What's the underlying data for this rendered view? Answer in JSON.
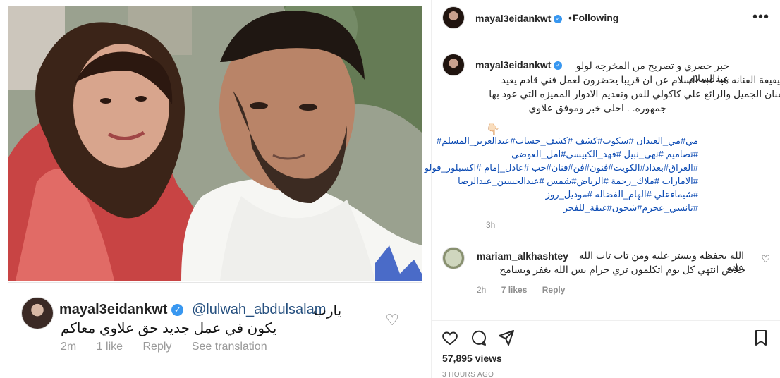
{
  "embedded_comment": {
    "username": "mayal3eidankwt",
    "mention": "@lulwah_abdulsalam",
    "text_line1": "يارب",
    "text_line2": "يكون في عمل جديد حق علاوي معاكم",
    "time": "2m",
    "likes": "1 like",
    "reply": "Reply",
    "translation": "See translation"
  },
  "header": {
    "username": "mayal3eidankwt",
    "following_label": "Following"
  },
  "caption": {
    "username": "mayal3eidankwt",
    "line1": "خبر حصري و تصريح من المخرجه لولو عبدالسلام",
    "line2": "شيقيقة الفنانه هيا عبد السلام عن ان قريبا يحضرون لعمل فني قادم يعيد",
    "line3": "الفنان الجميل والرائع علي كاكولي للفن وتقديم الادوار المميزه التي عود بها",
    "line4": "جمهوره. . احلى خبر وموفق علاوي",
    "emoji": "👇🏻",
    "hashtags": [
      "مي#مي_العيدان #سكوب#كشف #كشف_حساب#عبدالعزيز_المسلم#",
      "#تصاميم #نهى_نبيل #فهد_الكبيسي#امل_العوضي",
      "#العراق#بغداد#الكويت#فنون#فن#فنان#حب #عادل_إمام #اكسبلور_فولو",
      "#الامارات #ملاك_رحمة #الرياض#شمس #عبدالحسين_عبدالرضا",
      "#شيماءعلي #الهام_الفضاله #موديل_روز",
      "#نانسي_عجرم#شجون#غبقة_للفجر"
    ],
    "time": "3h"
  },
  "comment": {
    "username": "mariam_alkhashtey",
    "line1": "الله يحفظه ويستر عليه ومن تاب تاب الله عليه",
    "line2": "خلاص انتهي كل يوم اتكلمون تري حرام بس الله يغفر ويسامح",
    "time": "2h",
    "likes": "7 likes",
    "reply": "Reply"
  },
  "footer": {
    "views": "57,895 views",
    "time_ago": "3 HOURS AGO"
  }
}
